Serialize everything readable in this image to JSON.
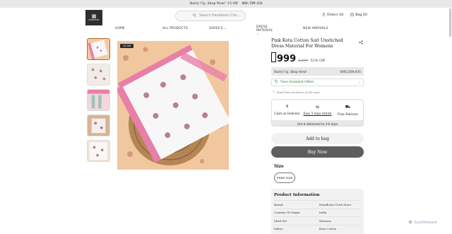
{
  "topbar": {
    "text": "Hurry Up, Shop Now! ·15 Off",
    "timer": "00H:25M:43S"
  },
  "header": {
    "logo_mark": "▦",
    "logo_text": "HANDLOOM",
    "search_placeholder": "Search Handloom Clot...",
    "orders_label": "Orders (0)",
    "bag_label": "Bag (0)"
  },
  "nav": [
    "HOME",
    "ALL PRODUCTS",
    "SAREE'S",
    "DRESS MATERIAL",
    "NEW ARRIVALS"
  ],
  "badge": "15 Off",
  "product": {
    "title": "Pink Kota Cotton Suit Unstiched Dress Material For Womens",
    "price": "999",
    "mrp": "2,099",
    "discount": "52% Off"
  },
  "hurry": {
    "text": "Hurry Up, Shop Now!",
    "timer": "00H:25M:43S"
  },
  "offers_label": "View Available Offers",
  "final_price_note": "Final Price inclusive of all taxes",
  "features": [
    {
      "icon": "₹",
      "label": "Cash on Delivery",
      "underline": false
    },
    {
      "icon": "⇆",
      "label": "Easy 5 days return",
      "underline": true
    },
    {
      "icon": "⛟",
      "label": "Free Delivery",
      "underline": false
    }
  ],
  "delivery_note": "Get it delivered in 3-6 days",
  "add_to_bag": "Add to bag",
  "buy_now": "Buy Now",
  "size_label": "Size",
  "size_option": "FREE SIZE",
  "info": {
    "heading": "Product Information",
    "rows": [
      {
        "k": "Brand",
        "v": "Handloom Cloth Store"
      },
      {
        "k": "Country Of Origin",
        "v": "India"
      },
      {
        "k": "Ideal For",
        "v": "Womens"
      },
      {
        "k": "Fabric",
        "v": "Kota Cotton"
      }
    ]
  },
  "watermark": "ScanMalware",
  "colors": {
    "accent": "#5e5e5e",
    "offer_green": "#2f7a3a",
    "pink_border": "#e87fa8",
    "peach": "#f2c9a4"
  }
}
